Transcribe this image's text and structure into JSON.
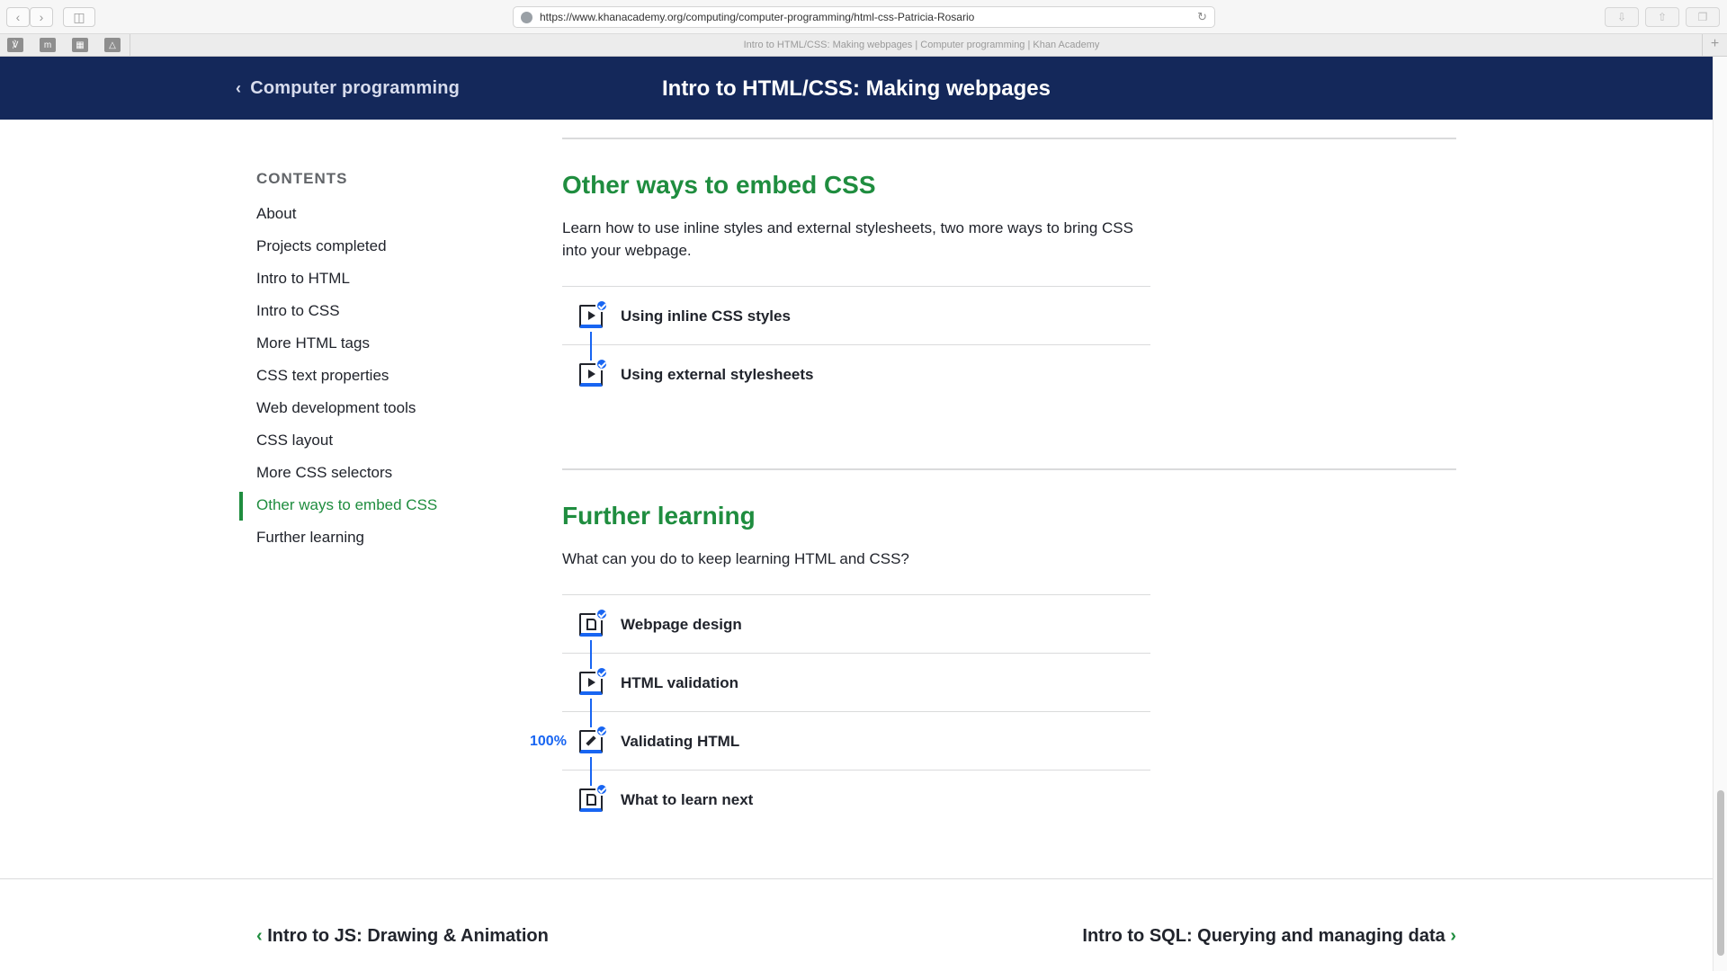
{
  "browser": {
    "url": "https://www.khanacademy.org/computing/computer-programming/html-css-Patricia-Rosario",
    "tab_title": "Intro to HTML/CSS: Making webpages | Computer programming | Khan Academy"
  },
  "header": {
    "back_label": "Computer programming",
    "title": "Intro to HTML/CSS: Making webpages",
    "background": "#14285a"
  },
  "sidebar": {
    "heading": "CONTENTS",
    "items": [
      {
        "label": "About"
      },
      {
        "label": "Projects completed"
      },
      {
        "label": "Intro to HTML"
      },
      {
        "label": "Intro to CSS"
      },
      {
        "label": "More HTML tags"
      },
      {
        "label": "CSS text properties"
      },
      {
        "label": "Web development tools"
      },
      {
        "label": "CSS layout"
      },
      {
        "label": "More CSS selectors"
      },
      {
        "label": "Other ways to embed CSS"
      },
      {
        "label": "Further learning"
      }
    ],
    "active_index": 9
  },
  "sections": [
    {
      "title": "Other ways to embed CSS",
      "description": "Learn how to use inline styles and external stylesheets, two more ways to bring CSS into your webpage.",
      "items": [
        {
          "label": "Using inline CSS styles",
          "icon": "video-icon"
        },
        {
          "label": "Using external stylesheets",
          "icon": "video-icon"
        }
      ]
    },
    {
      "title": "Further learning",
      "description": "What can you do to keep learning HTML and CSS?",
      "items": [
        {
          "label": "Webpage design",
          "icon": "article-icon"
        },
        {
          "label": "HTML validation",
          "icon": "video-icon"
        },
        {
          "label": "Validating HTML",
          "icon": "exercise-icon",
          "progress": "100%"
        },
        {
          "label": "What to learn next",
          "icon": "article-icon"
        }
      ]
    }
  ],
  "footer": {
    "prev_label": "Intro to JS: Drawing & Animation",
    "next_label": "Intro to SQL: Querying and managing data"
  },
  "colors": {
    "accent_green": "#1f8d3f",
    "accent_blue": "#1865f2",
    "text": "#21242c"
  }
}
